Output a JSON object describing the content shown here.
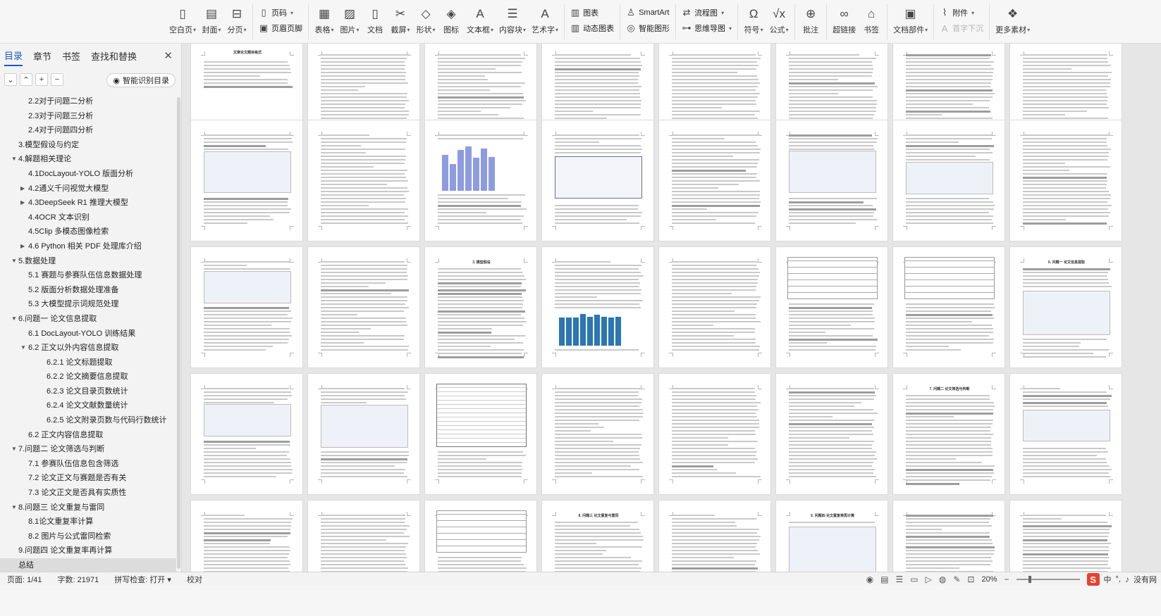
{
  "ribbon": {
    "groups": [
      {
        "type": "tools",
        "tools": [
          {
            "name": "blank-page-button",
            "icon": "▯",
            "label": "空白页",
            "caret": true
          },
          {
            "name": "cover-button",
            "icon": "▤",
            "label": "封面",
            "caret": true
          },
          {
            "name": "page-break-button",
            "icon": "⊟",
            "label": "分页",
            "caret": true
          }
        ]
      },
      {
        "type": "stack",
        "rows": [
          {
            "name": "page-number-button",
            "icon": "▯",
            "label": "页码",
            "caret": true
          },
          {
            "name": "header-footer-button",
            "icon": "▣",
            "label": "页眉页脚",
            "caret": false
          }
        ]
      },
      {
        "type": "tools",
        "tools": [
          {
            "name": "table-button",
            "icon": "▦",
            "label": "表格",
            "caret": true
          },
          {
            "name": "picture-button",
            "icon": "▨",
            "label": "图片",
            "caret": true
          },
          {
            "name": "document-button",
            "icon": "▯",
            "label": "文档",
            "caret": false
          },
          {
            "name": "screenshot-button",
            "icon": "✂",
            "label": "截屏",
            "caret": true
          },
          {
            "name": "shape-button",
            "icon": "◇",
            "label": "形状",
            "caret": true
          },
          {
            "name": "icon-button",
            "icon": "◈",
            "label": "图标",
            "caret": false
          },
          {
            "name": "textbox-button",
            "icon": "A",
            "label": "文本框",
            "caret": true
          },
          {
            "name": "content-block-button",
            "icon": "☰",
            "label": "内容块",
            "caret": true
          },
          {
            "name": "wordart-button",
            "icon": "A",
            "label": "艺术字",
            "caret": true
          }
        ]
      },
      {
        "type": "stack",
        "rows": [
          {
            "name": "chart-button",
            "icon": "▥",
            "label": "图表",
            "caret": false
          },
          {
            "name": "dynamic-chart-button",
            "icon": "▥",
            "label": "动态图表",
            "caret": false
          }
        ]
      },
      {
        "type": "stack",
        "rows": [
          {
            "name": "smartart-button",
            "icon": "♙",
            "label": "SmartArt",
            "caret": false
          },
          {
            "name": "smart-shape-button",
            "icon": "◎",
            "label": "智能图形",
            "caret": false
          }
        ]
      },
      {
        "type": "stack",
        "rows": [
          {
            "name": "flowchart-button",
            "icon": "⇄",
            "label": "流程图",
            "caret": true
          },
          {
            "name": "mindmap-button",
            "icon": "⊶",
            "label": "思维导图",
            "caret": true
          }
        ]
      },
      {
        "type": "tools",
        "tools": [
          {
            "name": "symbol-button",
            "icon": "Ω",
            "label": "符号",
            "caret": true
          },
          {
            "name": "formula-button",
            "icon": "√x",
            "label": "公式",
            "caret": true
          }
        ]
      },
      {
        "type": "tools",
        "tools": [
          {
            "name": "comment-button",
            "icon": "⊕",
            "label": "批注",
            "caret": false
          }
        ]
      },
      {
        "type": "tools",
        "tools": [
          {
            "name": "hyperlink-button",
            "icon": "∞",
            "label": "超链接",
            "caret": false
          },
          {
            "name": "bookmark-button",
            "icon": "⌂",
            "label": "书签",
            "caret": false
          }
        ]
      },
      {
        "type": "tools",
        "tools": [
          {
            "name": "doc-parts-button",
            "icon": "▣",
            "label": "文档部件",
            "caret": true
          }
        ]
      },
      {
        "type": "stack",
        "rows": [
          {
            "name": "attachment-button",
            "icon": "⌇",
            "label": "附件",
            "caret": true
          },
          {
            "name": "drop-cap-button",
            "icon": "A",
            "label": "首字下沉",
            "caret": false,
            "disabled": true
          }
        ]
      },
      {
        "type": "tools",
        "tools": [
          {
            "name": "more-materials-button",
            "icon": "❖",
            "label": "更多素材",
            "caret": true
          }
        ]
      }
    ]
  },
  "sidebar": {
    "tabs": [
      "目录",
      "章节",
      "书签",
      "查找和替换"
    ],
    "active_tab": 0,
    "close": "✕",
    "tool_buttons": [
      "⌄",
      "⌃",
      "+",
      "−"
    ],
    "smart_toc": "智能识别目录",
    "toc": [
      {
        "label": "2.2对于问题二分析",
        "level": 2,
        "expander": ""
      },
      {
        "label": "2.3对于问题三分析",
        "level": 2,
        "expander": ""
      },
      {
        "label": "2.4对于问题四分析",
        "level": 2,
        "expander": ""
      },
      {
        "label": "3.模型假设与约定",
        "level": 1,
        "expander": ""
      },
      {
        "label": "4.解题相关理论",
        "level": 1,
        "expander": "▼"
      },
      {
        "label": "4.1DocLayout-YOLO 版面分析",
        "level": 2,
        "expander": ""
      },
      {
        "label": "4.2通义千问视觉大模型",
        "level": 2,
        "expander": "▶"
      },
      {
        "label": "4.3DeepSeek R1 推理大模型",
        "level": 2,
        "expander": "▶"
      },
      {
        "label": "4.4OCR 文本识别",
        "level": 2,
        "expander": ""
      },
      {
        "label": "4.5Clip 多模态图像检索",
        "level": 2,
        "expander": ""
      },
      {
        "label": "4.6 Python 相关 PDF 处理库介绍",
        "level": 2,
        "expander": "▶"
      },
      {
        "label": "5.数据处理",
        "level": 1,
        "expander": "▼"
      },
      {
        "label": "5.1 赛题与参赛队伍信息数据处理",
        "level": 2,
        "expander": ""
      },
      {
        "label": "5.2 版面分析数据处理准备",
        "level": 2,
        "expander": ""
      },
      {
        "label": "5.3 大模型提示词规范处理",
        "level": 2,
        "expander": ""
      },
      {
        "label": "6.问题一 论文信息提取",
        "level": 1,
        "expander": "▼"
      },
      {
        "label": "6.1 DocLayout-YOLO 训练结果",
        "level": 2,
        "expander": ""
      },
      {
        "label": "6.2 正文以外内容信息提取",
        "level": 2,
        "expander": "▼"
      },
      {
        "label": "6.2.1 论文标题提取",
        "level": 3,
        "expander": ""
      },
      {
        "label": "6.2.2 论文摘要信息提取",
        "level": 3,
        "expander": ""
      },
      {
        "label": "6.2.3 论文目录页数统计",
        "level": 3,
        "expander": ""
      },
      {
        "label": "6.2.4 论文文献数量统计",
        "level": 3,
        "expander": ""
      },
      {
        "label": "6.2.5 论文附录页数与代码行数统计",
        "level": 3,
        "expander": ""
      },
      {
        "label": "6.2 正文内容信息提取",
        "level": 2,
        "expander": ""
      },
      {
        "label": "7.问题二 论文筛选与判断",
        "level": 1,
        "expander": "▼"
      },
      {
        "label": "7.1 参赛队伍信息包含筛选",
        "level": 2,
        "expander": ""
      },
      {
        "label": "7.2 论文正文与赛题是否有关",
        "level": 2,
        "expander": ""
      },
      {
        "label": "7.3 论文正文是否具有实质性",
        "level": 2,
        "expander": ""
      },
      {
        "label": "8.问题三 论文重复与雷同",
        "level": 1,
        "expander": "▼"
      },
      {
        "label": "8.1论文重复率计算",
        "level": 2,
        "expander": ""
      },
      {
        "label": "8.2 图片与公式雷同检索",
        "level": 2,
        "expander": ""
      },
      {
        "label": "9.问题四 论文重复率再计算",
        "level": 1,
        "expander": ""
      },
      {
        "label": "总结",
        "level": 1,
        "expander": "",
        "selected": true
      }
    ]
  },
  "pages": {
    "titles": [
      "文章论文题目格式",
      "",
      "",
      "",
      "",
      "",
      "",
      "",
      "",
      "",
      "",
      "",
      "",
      "",
      "",
      "",
      "",
      "",
      "3. 模型假设",
      "",
      "",
      "",
      "",
      "6. 问题一 论文信息提取",
      "",
      "",
      "",
      "",
      "",
      "",
      "7. 问题二 论文筛选与判断",
      "",
      "",
      "",
      "",
      "8. 问题三 论文重复与雷同",
      "",
      "9. 问题四 论文重复率再计算",
      "",
      ""
    ]
  },
  "status": {
    "page": "页面: 1/41",
    "words": "字数: 21971",
    "spell": "拼写检查: 打开",
    "spell_caret": "▾",
    "proof": "校对",
    "zoom": "20%",
    "zoom_fraction": 0.2,
    "ime_logo": "S",
    "ime_lang": "中",
    "ime_extra": "°,",
    "network": "没有网"
  }
}
